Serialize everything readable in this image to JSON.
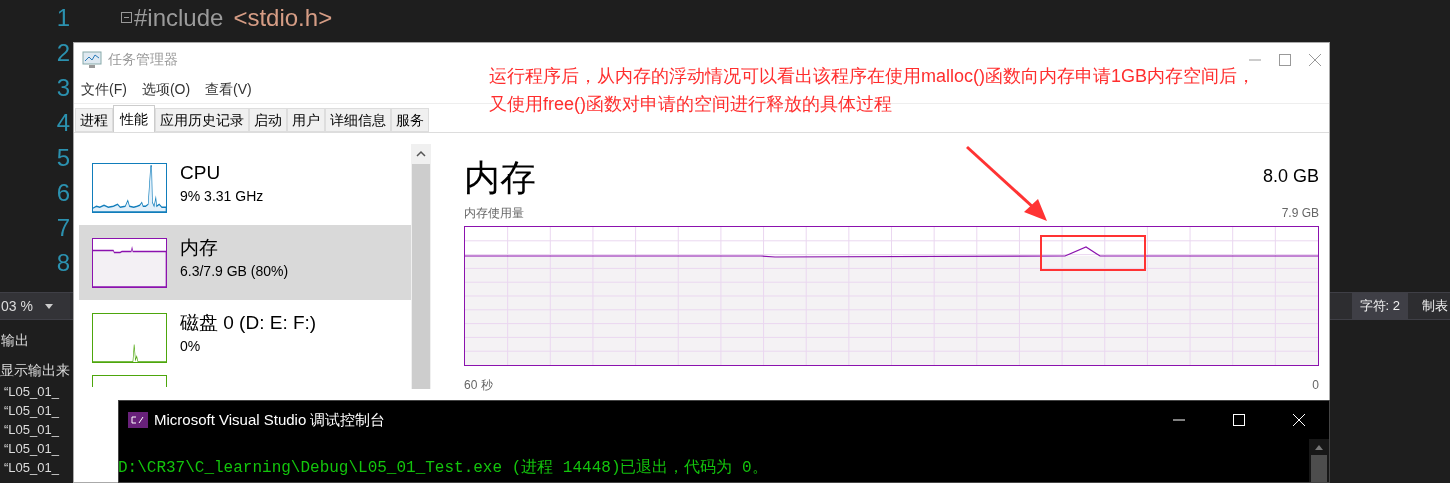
{
  "editor": {
    "lines": [
      {
        "number": "1",
        "code": [
          {
            "text": "#include",
            "kind": "directive"
          },
          {
            "text": "<stdio.h>",
            "kind": "string"
          }
        ]
      },
      {
        "number": "2"
      },
      {
        "number": "3"
      },
      {
        "number": "4"
      },
      {
        "number": "5"
      },
      {
        "number": "6"
      },
      {
        "number": "7"
      },
      {
        "number": "8"
      }
    ]
  },
  "status_bar": {
    "zoom": "03 %",
    "chars": "字符: 2",
    "tab_mode": "制表"
  },
  "output_panel": {
    "title": "输出",
    "source_label": "显示输出来",
    "lines": [
      "“L05_01_",
      "“L05_01_",
      "“L05_01_",
      "“L05_01_",
      "“L05_01_"
    ]
  },
  "task_manager": {
    "title": "任务管理器",
    "menu": [
      "文件(F)",
      "选项(O)",
      "查看(V)"
    ],
    "tabs": [
      {
        "label": "进程",
        "selected": false
      },
      {
        "label": "性能",
        "selected": true
      },
      {
        "label": "应用历史记录",
        "selected": false
      },
      {
        "label": "启动",
        "selected": false
      },
      {
        "label": "用户",
        "selected": false
      },
      {
        "label": "详细信息",
        "selected": false
      },
      {
        "label": "服务",
        "selected": false
      }
    ],
    "sidebar": {
      "items": [
        {
          "kind": "cpu",
          "name": "CPU",
          "detail": "9% 3.31 GHz",
          "color": "#117dbb",
          "selected": false
        },
        {
          "kind": "memory",
          "name": "内存",
          "detail": "6.3/7.9 GB (80%)",
          "color": "#8b12ae",
          "selected": true
        },
        {
          "kind": "disk",
          "name": "磁盘 0 (D: E: F:)",
          "detail": "0%",
          "color": "#4da60c",
          "selected": false
        },
        {
          "kind": "partial",
          "color": "#4da60c",
          "selected": false
        }
      ]
    },
    "main": {
      "title": "内存",
      "total": "8.0 GB",
      "usage_label": "内存使用量",
      "max_label": "7.9 GB",
      "time_start": "60 秒",
      "time_end": "0"
    }
  },
  "annotation": {
    "lines": [
      "运行程序后，从内存的浮动情况可以看出该程序在使用malloc()函数向内存申请1GB内存空间后，",
      "又使用free()函数对申请的空间进行释放的具体过程"
    ]
  },
  "console": {
    "title": "Microsoft Visual Studio 调试控制台",
    "lines": [
      "D:\\CR37\\C_learning\\Debug\\L05_01_Test.exe (进程 14448)已退出，代码为 0。"
    ]
  }
}
